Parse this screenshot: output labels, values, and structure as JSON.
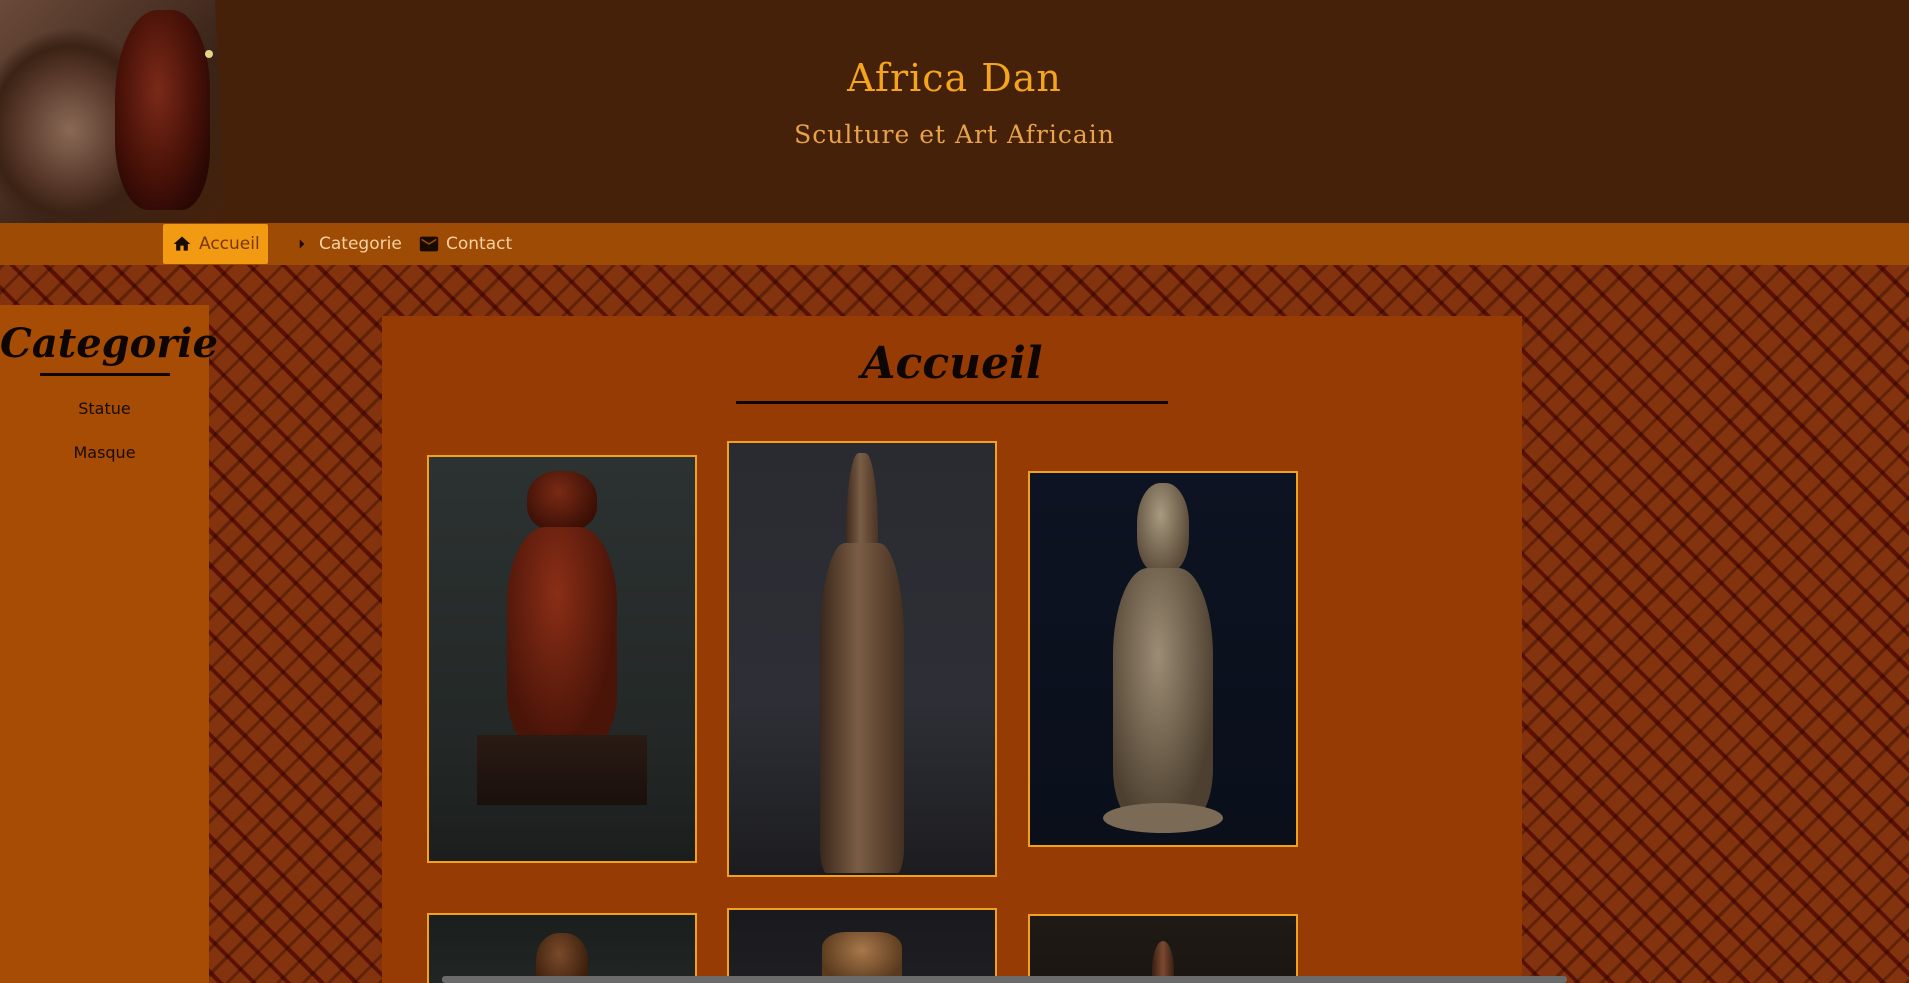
{
  "header": {
    "title": "Africa Dan",
    "subtitle": "Sculture et Art Africain"
  },
  "nav": {
    "items": [
      {
        "label": "Accueil",
        "icon": "home-icon",
        "active": true
      },
      {
        "label": "Categorie",
        "icon": "caret-right-icon",
        "active": false
      },
      {
        "label": "Contact",
        "icon": "mail-icon",
        "active": false
      }
    ]
  },
  "sidebar": {
    "title": "Categorie",
    "links": [
      "Statue",
      "Masque"
    ]
  },
  "main": {
    "title": "Accueil",
    "gallery_count_visible": 6
  },
  "colors": {
    "header_bg": "#45210a",
    "nav_bg": "#9e4b05",
    "nav_active": "#f29a12",
    "title_color": "#f4a51b",
    "sidebar_bg": "#a64c05",
    "main_bg": "#963b03",
    "thumb_border": "#f2a11a"
  }
}
